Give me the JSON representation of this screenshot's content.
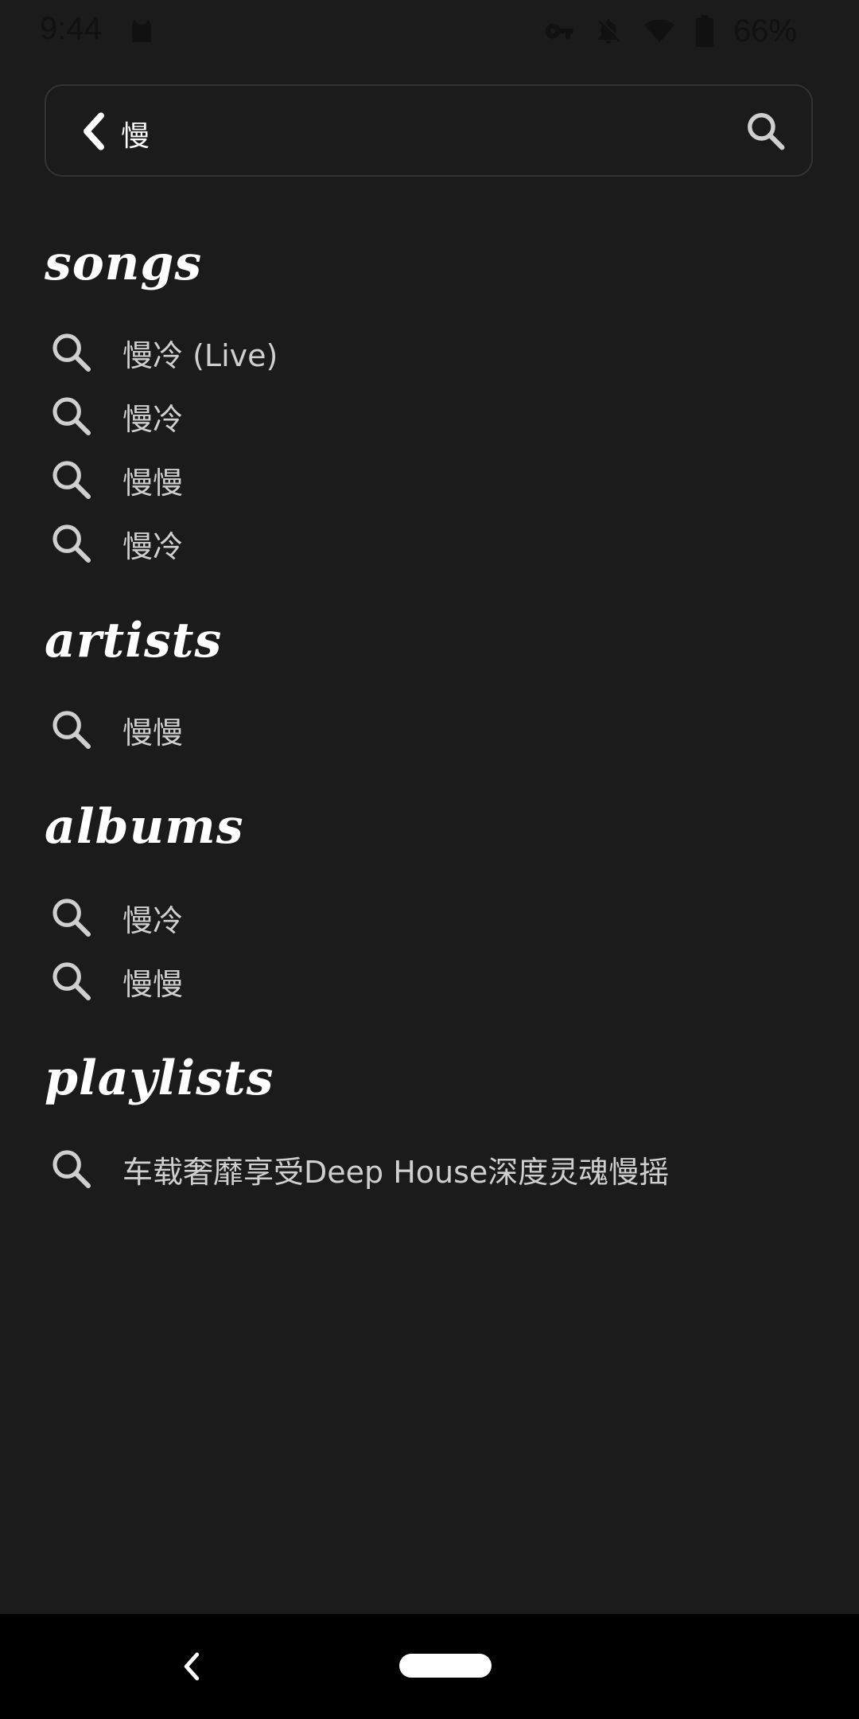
{
  "status_bar": {
    "time": "9:44",
    "battery": "66%",
    "icons": [
      "cat-icon",
      "vpn-key-icon",
      "bell-off-icon",
      "wifi-icon",
      "battery-icon"
    ]
  },
  "search": {
    "query": "慢",
    "icons": [
      "back-arrow-icon",
      "search-icon"
    ]
  },
  "sections": {
    "songs": {
      "title": "songs",
      "items": [
        "慢冷 (Live)",
        "慢冷",
        "慢慢",
        "慢冷"
      ]
    },
    "artists": {
      "title": "artists",
      "items": [
        "慢慢"
      ]
    },
    "albums": {
      "title": "albums",
      "items": [
        "慢冷",
        "慢慢"
      ]
    },
    "playlists": {
      "title": "playlists",
      "items": [
        "车载奢靡享受Deep House深度灵魂慢摇"
      ]
    }
  },
  "nav_bar": {
    "icons": [
      "nav-back-icon",
      "home-pill"
    ]
  },
  "colors": {
    "background": "#1b1b1b",
    "title": "#ffffff",
    "item_text": "#cfcfcf",
    "icon": "#cfcfcf",
    "nav_bg": "#000000"
  }
}
